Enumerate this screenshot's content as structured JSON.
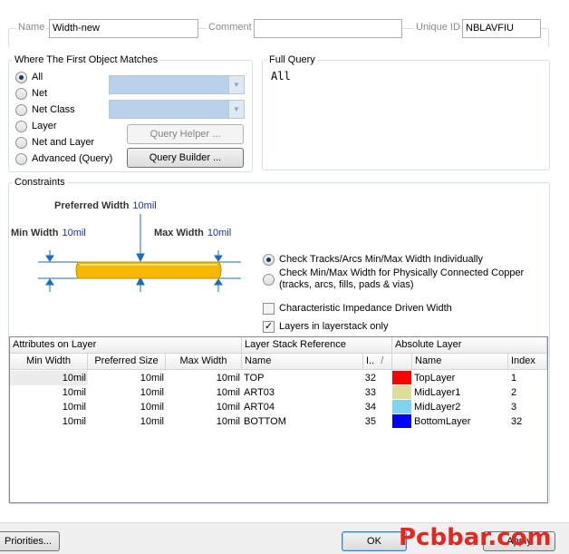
{
  "top": {
    "name_label": "Name",
    "name_value": "Width-new",
    "comment_label": "Comment",
    "comment_value": "",
    "uid_label": "Unique ID",
    "uid_value": "NBLAVFIU"
  },
  "match": {
    "title": "Where The First Object Matches",
    "options": [
      "All",
      "Net",
      "Net Class",
      "Layer",
      "Net and Layer",
      "Advanced (Query)"
    ],
    "selected": "All",
    "query_helper": "Query Helper ...",
    "query_builder": "Query Builder ..."
  },
  "full_query": {
    "title": "Full Query",
    "text": "All"
  },
  "constraints": {
    "title": "Constraints",
    "preferred_width_label": "Preferred Width",
    "preferred_width_value": "10mil",
    "min_width_label": "Min Width",
    "min_width_value": "10mil",
    "max_width_label": "Max Width",
    "max_width_value": "10mil",
    "opt_individual": "Check Tracks/Arcs Min/Max Width Individually",
    "opt_connected_1": "Check Min/Max Width for Physically Connected Copper",
    "opt_connected_2": "(tracks, arcs, fills, pads & vias)",
    "chk_impedance": "Characteristic Impedance Driven Width",
    "chk_layerstack": "Layers in layerstack only",
    "chk_impedance_checked": false,
    "chk_layerstack_checked": true,
    "check_mark": "✓"
  },
  "table": {
    "group_headers": [
      "Attributes on Layer",
      "Layer Stack Reference",
      "Absolute Layer"
    ],
    "col_headers": {
      "min_width": "Min Width",
      "preferred_size": "Preferred Size",
      "max_width": "Max Width",
      "name": "Name",
      "index_short": "I..",
      "sort_glyph": "/",
      "abs_name": "Name",
      "abs_index": "Index"
    },
    "rows": [
      {
        "min": "10mil",
        "pref": "10mil",
        "max": "10mil",
        "ref_name": "TOP",
        "ref_index": "32",
        "color": "#ff0000",
        "abs_name": "TopLayer",
        "abs_index": "1"
      },
      {
        "min": "10mil",
        "pref": "10mil",
        "max": "10mil",
        "ref_name": "ART03",
        "ref_index": "33",
        "color": "#dedd9b",
        "abs_name": "MidLayer1",
        "abs_index": "2"
      },
      {
        "min": "10mil",
        "pref": "10mil",
        "max": "10mil",
        "ref_name": "ART04",
        "ref_index": "34",
        "color": "#7fd5f0",
        "abs_name": "MidLayer2",
        "abs_index": "3"
      },
      {
        "min": "10mil",
        "pref": "10mil",
        "max": "10mil",
        "ref_name": "BOTTOM",
        "ref_index": "35",
        "color": "#0000ff",
        "abs_name": "BottomLayer",
        "abs_index": "32"
      }
    ]
  },
  "footer": {
    "priorities": "Priorities...",
    "ok": "OK",
    "apply": "Apply",
    "watermark": "Pcbbar.com"
  }
}
